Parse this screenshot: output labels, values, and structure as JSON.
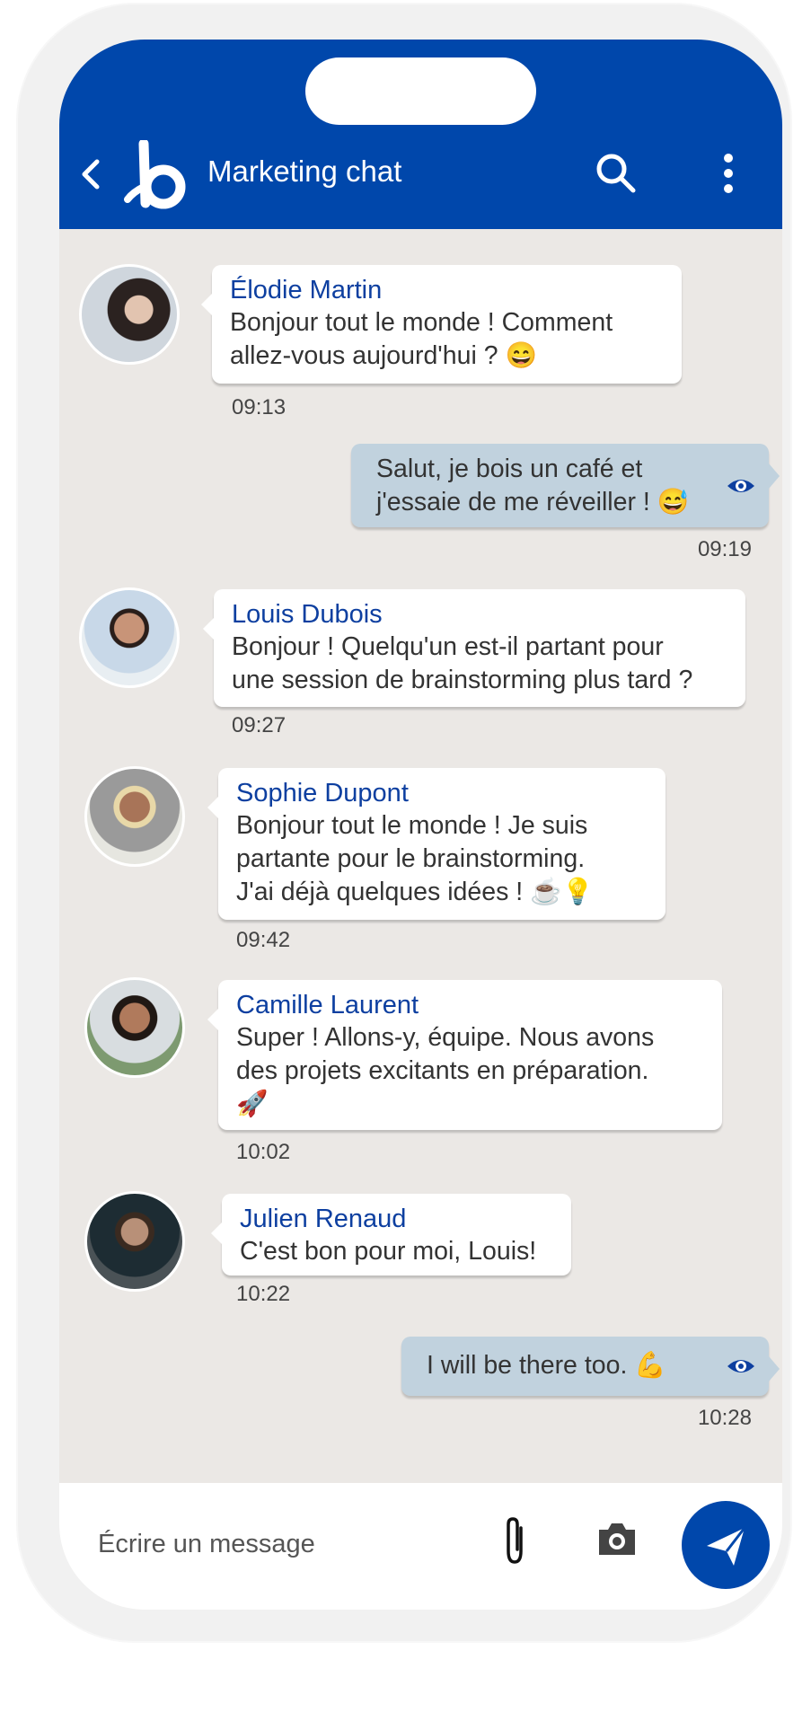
{
  "header": {
    "title": "Marketing chat",
    "brand_color": "#0047ab",
    "icons": [
      "chevron-left-icon",
      "logo-b",
      "search-icon",
      "more-vertical-icon"
    ]
  },
  "messages": [
    {
      "direction": "in",
      "sender": "Élodie Martin",
      "text": "Bonjour tout le monde ! Comment\nallez-vous aujourd'hui ? 😄",
      "time": "09:13"
    },
    {
      "direction": "out",
      "text": "Salut, je bois un café et\nj'essaie de me réveiller ! 😅",
      "time": "09:19",
      "status_icon": "eye-icon"
    },
    {
      "direction": "in",
      "sender": "Louis Dubois",
      "text": "Bonjour ! Quelqu'un est-il partant pour\nune session de brainstorming plus tard ?",
      "time": "09:27"
    },
    {
      "direction": "in",
      "sender": "Sophie Dupont",
      "text": "Bonjour tout le monde ! Je suis\npartante pour le brainstorming.\nJ'ai déjà quelques idées ! ☕💡",
      "time": "09:42"
    },
    {
      "direction": "in",
      "sender": "Camille Laurent",
      "text": "Super ! Allons-y, équipe. Nous avons\ndes projets excitants en préparation.\n🚀",
      "time": "10:02"
    },
    {
      "direction": "in",
      "sender": "Julien Renaud",
      "text": "C'est bon pour moi, Louis!",
      "time": "10:22"
    },
    {
      "direction": "out",
      "text": "I will be there too. 💪",
      "time": "10:28",
      "status_icon": "eye-icon"
    }
  ],
  "composer": {
    "placeholder": "Écrire un message",
    "icons": [
      "paperclip-icon",
      "camera-icon",
      "send-icon"
    ]
  },
  "colors": {
    "chat_bg": "#ebe8e5",
    "sent_bubble": "#c1d2de",
    "received_bubble": "#ffffff",
    "sender_name": "#0d3fa0"
  }
}
